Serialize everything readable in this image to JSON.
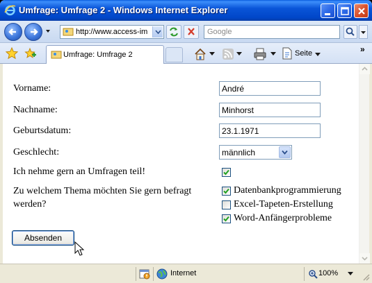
{
  "window": {
    "title": "Umfrage: Umfrage 2 - Windows Internet Explorer"
  },
  "address": {
    "url": "http://www.access-im"
  },
  "search": {
    "placeholder": "Google"
  },
  "tab": {
    "label": "Umfrage: Umfrage 2"
  },
  "commandbar": {
    "page_label": "Seite",
    "more": "»"
  },
  "form": {
    "first_name": {
      "label": "Vorname:",
      "value": "André"
    },
    "last_name": {
      "label": "Nachname:",
      "value": "Minhorst"
    },
    "birthdate": {
      "label": "Geburtsdatum:",
      "value": "23.1.1971"
    },
    "gender": {
      "label": "Geschlecht:",
      "value": "männlich"
    },
    "survey_optin": {
      "label": "Ich nehme gern an Umfragen teil!",
      "checked": true
    },
    "topic": {
      "label_line1": "Zu welchem Thema möchten Sie gern befragt",
      "label_line2": "werden?",
      "options": [
        {
          "label": "Datenbankprogrammierung",
          "checked": true
        },
        {
          "label": "Excel-Tapeten-Erstellung",
          "checked": false
        },
        {
          "label": "Word-Anfängerprobleme",
          "checked": true
        }
      ]
    },
    "submit_label": "Absenden"
  },
  "status": {
    "zone": "Internet",
    "zoom": "100%"
  }
}
